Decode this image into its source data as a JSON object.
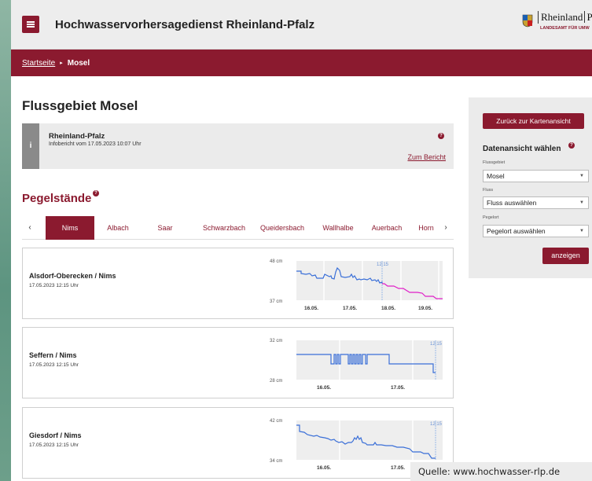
{
  "header": {
    "title": "Hochwasservorhersagedienst Rheinland-Pfalz",
    "logo_name": "Rheinland",
    "logo_name2": "Pfalz",
    "logo_sub": "LANDESAMT FÜR UMW"
  },
  "breadcrumb": {
    "home": "Startseite",
    "separator": "▸",
    "current": "Mosel"
  },
  "main": {
    "title": "Flussgebiet Mosel",
    "info": {
      "icon": "i",
      "region": "Rheinland-Pfalz",
      "date": "Infobericht vom 17.05.2023 10:07 Uhr",
      "help": "?",
      "link": "Zum Bericht"
    },
    "section_title": "Pegelstände",
    "section_help": "?",
    "tabs": [
      {
        "label": "Nims",
        "active": true
      },
      {
        "label": "Albach",
        "active": false
      },
      {
        "label": "Saar",
        "active": false
      },
      {
        "label": "Schwarzbach",
        "active": false
      },
      {
        "label": "Queidersbach",
        "active": false
      },
      {
        "label": "Wallhalbe",
        "active": false
      },
      {
        "label": "Auerbach",
        "active": false
      },
      {
        "label": "Horn",
        "active": false
      }
    ],
    "tab_prev": "‹",
    "tab_next": "›"
  },
  "gauges": [
    {
      "name": "Alsdorf-Oberecken / Nims",
      "time": "17.05.2023 12:15 Uhr",
      "ymax": "48 cm",
      "ymin": "37 cm",
      "now": "12:15",
      "dates": [
        "16.05.",
        "17.05.",
        "18.05.",
        "19.05."
      ]
    },
    {
      "name": "Seffern / Nims",
      "time": "17.05.2023 12:15 Uhr",
      "ymax": "32 cm",
      "ymin": "28 cm",
      "now": "12:15",
      "dates": [
        "16.05.",
        "17.05."
      ]
    },
    {
      "name": "Giesdorf / Nims",
      "time": "17.05.2023 12:15 Uhr",
      "ymax": "42 cm",
      "ymin": "34 cm",
      "now": "12:15",
      "dates": [
        "16.05.",
        "17.05."
      ]
    }
  ],
  "sidebar": {
    "back_button": "Zurück zur Kartenansicht",
    "title": "Datenansicht wählen",
    "help": "?",
    "fields": [
      {
        "label": "Flussgebiet",
        "value": "Mosel"
      },
      {
        "label": "Fluss",
        "value": "Fluss auswählen"
      },
      {
        "label": "Pegelort",
        "value": "Pegelort auswählen"
      }
    ],
    "submit": "anzeigen"
  },
  "caption": "Quelle: www.hochwasser-rlp.de",
  "colors": {
    "accent": "#8b1a2f",
    "measured": "#3a6fd8",
    "forecast": "#e020c8"
  }
}
